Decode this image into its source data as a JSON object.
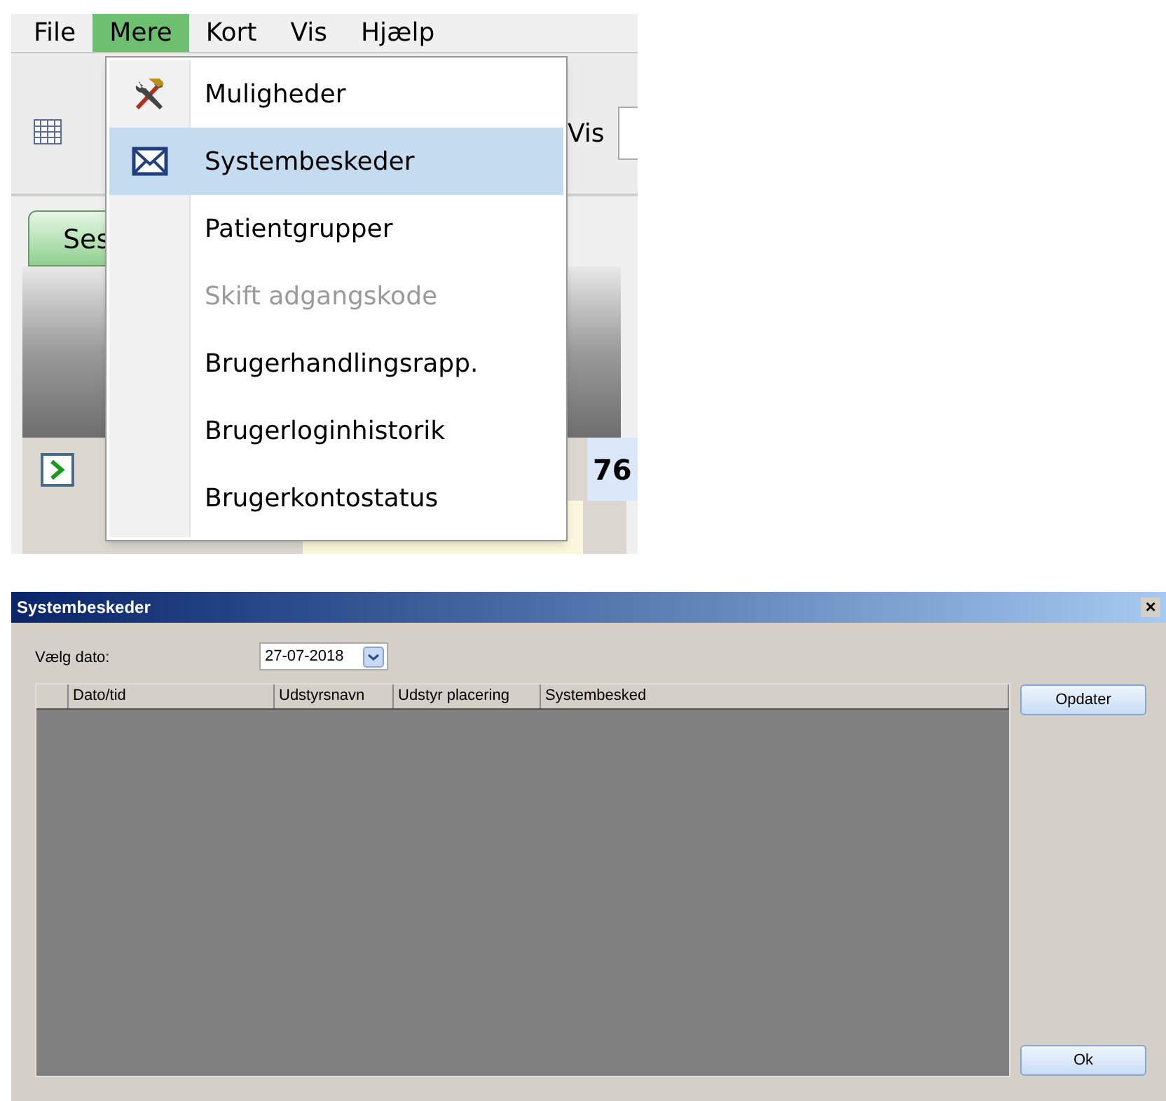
{
  "menu_bar": {
    "items": [
      {
        "label": "File",
        "selected": false
      },
      {
        "label": "Mere",
        "selected": true
      },
      {
        "label": "Kort",
        "selected": false
      },
      {
        "label": "Vis",
        "selected": false
      },
      {
        "label": "Hjælp",
        "selected": false
      }
    ]
  },
  "toolbar": {
    "view_label": "Vis"
  },
  "tabs": [
    {
      "label": "Ses",
      "selected": true
    }
  ],
  "table": {
    "rows": [
      {
        "cell": "76"
      }
    ]
  },
  "menu": {
    "items": [
      {
        "label": "Muligheder",
        "kind": "tools",
        "selected": false,
        "disabled": false
      },
      {
        "label": "Systembeskeder",
        "kind": "mail",
        "selected": true,
        "disabled": false
      },
      {
        "label": "Patientgrupper",
        "kind": "plain",
        "selected": false,
        "disabled": false
      },
      {
        "label": "Skift adgangskode",
        "kind": "plain",
        "selected": false,
        "disabled": true
      },
      {
        "label": "Brugerhandlingsrapp.",
        "kind": "plain",
        "selected": false,
        "disabled": false
      },
      {
        "label": "Brugerloginhistorik",
        "kind": "plain",
        "selected": false,
        "disabled": false
      },
      {
        "label": "Brugerkontostatus",
        "kind": "plain",
        "selected": false,
        "disabled": false
      }
    ]
  },
  "dialog": {
    "title": "Systembeskeder",
    "close": "×",
    "date_label": "Vælg dato:",
    "date_value": "27-07-2018",
    "columns": [
      "Dato/tid",
      "Udstyrsnavn",
      "Udstyr placering",
      "Systembesked"
    ],
    "buttons": [
      {
        "label": "Opdater"
      },
      {
        "label": "Ok"
      }
    ]
  }
}
